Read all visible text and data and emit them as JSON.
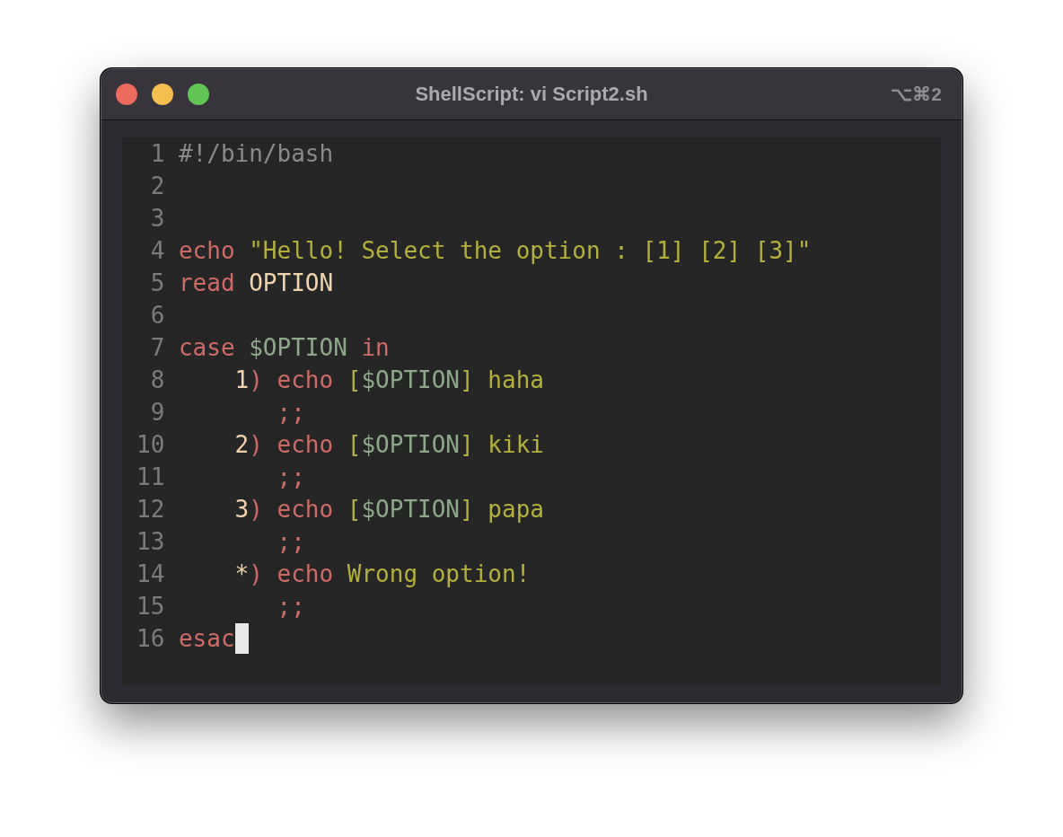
{
  "window": {
    "title": "ShellScript: vi Script2.sh",
    "shortcut": "⌥⌘2"
  },
  "editor": {
    "cursor_visible": true,
    "lines": [
      {
        "number": "1",
        "tokens": [
          {
            "kind": "comment",
            "text": "#!/bin/bash"
          }
        ]
      },
      {
        "number": "2"
      },
      {
        "number": "3"
      },
      {
        "number": "4",
        "tokens": [
          {
            "kind": "keyword",
            "text": "echo "
          },
          {
            "kind": "string",
            "text": "\"Hello! Select the option : [1] [2] [3]\""
          }
        ]
      },
      {
        "number": "5",
        "tokens": [
          {
            "kind": "keyword",
            "text": "read "
          },
          {
            "kind": "literal",
            "text": "OPTION"
          }
        ]
      },
      {
        "number": "6"
      },
      {
        "number": "7",
        "tokens": [
          {
            "kind": "keyword",
            "text": "case "
          },
          {
            "kind": "variable",
            "text": "$OPTION"
          },
          {
            "kind": "keyword",
            "text": " in"
          }
        ]
      },
      {
        "number": "8",
        "tokens": [
          {
            "kind": "literal",
            "text": "    1"
          },
          {
            "kind": "keyword",
            "text": ") echo "
          },
          {
            "kind": "string",
            "text": "["
          },
          {
            "kind": "variable",
            "text": "$OPTION"
          },
          {
            "kind": "string",
            "text": "] haha"
          }
        ]
      },
      {
        "number": "9",
        "tokens": [
          {
            "kind": "keyword",
            "text": "       ;;"
          }
        ]
      },
      {
        "number": "10",
        "tokens": [
          {
            "kind": "literal",
            "text": "    2"
          },
          {
            "kind": "keyword",
            "text": ") echo "
          },
          {
            "kind": "string",
            "text": "["
          },
          {
            "kind": "variable",
            "text": "$OPTION"
          },
          {
            "kind": "string",
            "text": "] kiki"
          }
        ]
      },
      {
        "number": "11",
        "tokens": [
          {
            "kind": "keyword",
            "text": "       ;;"
          }
        ]
      },
      {
        "number": "12",
        "tokens": [
          {
            "kind": "literal",
            "text": "    3"
          },
          {
            "kind": "keyword",
            "text": ") echo "
          },
          {
            "kind": "string",
            "text": "["
          },
          {
            "kind": "variable",
            "text": "$OPTION"
          },
          {
            "kind": "string",
            "text": "] papa"
          }
        ]
      },
      {
        "number": "13",
        "tokens": [
          {
            "kind": "keyword",
            "text": "       ;;"
          }
        ]
      },
      {
        "number": "14",
        "tokens": [
          {
            "kind": "literal",
            "text": "    *"
          },
          {
            "kind": "keyword",
            "text": ") echo "
          },
          {
            "kind": "string",
            "text": "Wrong option!"
          }
        ]
      },
      {
        "number": "15",
        "tokens": [
          {
            "kind": "keyword",
            "text": "       ;;"
          }
        ]
      },
      {
        "number": "16",
        "tokens": [
          {
            "kind": "keyword",
            "text": "esac"
          }
        ]
      }
    ]
  }
}
